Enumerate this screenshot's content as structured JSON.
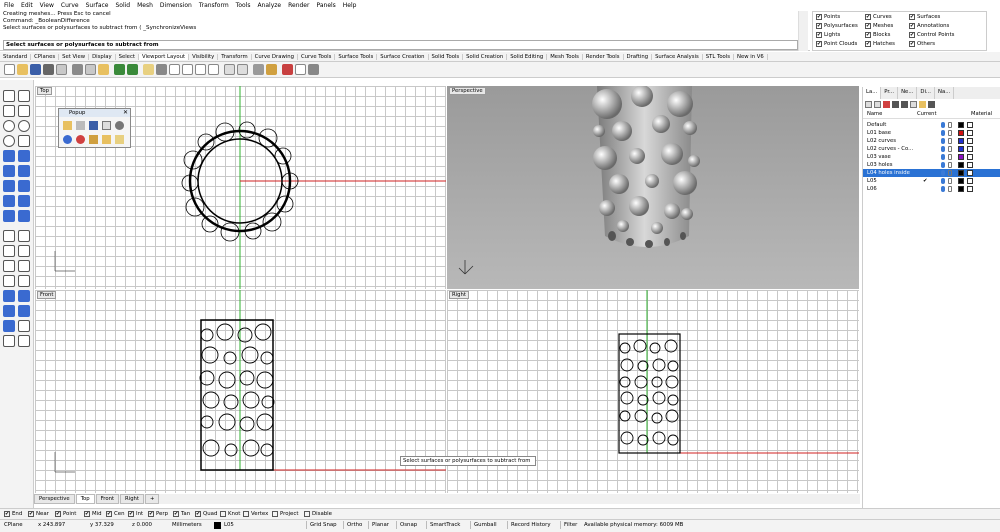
{
  "menu": [
    "File",
    "Edit",
    "View",
    "Curve",
    "Surface",
    "Solid",
    "Mesh",
    "Dimension",
    "Transform",
    "Tools",
    "Analyze",
    "Render",
    "Panels",
    "Help"
  ],
  "command": {
    "history": [
      "Creating meshes... Press Esc to cancel",
      "Command: _BooleanDifference",
      "Select surfaces or polysurfaces to subtract from ( _SynchronizeViews"
    ],
    "prompt": "Select surfaces or polysurfaces to subtract from"
  },
  "filter_checks": [
    {
      "label": "Points",
      "checked": true
    },
    {
      "label": "Curves",
      "checked": true
    },
    {
      "label": "Surfaces",
      "checked": true
    },
    {
      "label": "Polysurfaces",
      "checked": true
    },
    {
      "label": "Meshes",
      "checked": true
    },
    {
      "label": "Annotations",
      "checked": true
    },
    {
      "label": "Lights",
      "checked": true
    },
    {
      "label": "Blocks",
      "checked": true
    },
    {
      "label": "Control Points",
      "checked": true
    },
    {
      "label": "Point Clouds",
      "checked": true
    },
    {
      "label": "Hatches",
      "checked": true
    },
    {
      "label": "Others",
      "checked": true
    }
  ],
  "toolbar_tabs": [
    "Standard",
    "CPlanes",
    "Set View",
    "Display",
    "Select",
    "Viewport Layout",
    "Visibility",
    "Transform",
    "Curve Drawing",
    "Curve Tools",
    "Surface Tools",
    "Surface Creation",
    "Solid Tools",
    "Solid Creation",
    "Solid Editing",
    "Mesh Tools",
    "Render Tools",
    "Drafting",
    "Surface Analysis",
    "STL Tools",
    "New in V6"
  ],
  "active_toolbar_tab": "Viewport Layout",
  "viewports": {
    "top": "Top",
    "perspective": "Perspective",
    "front": "Front",
    "right": "Right"
  },
  "popup": {
    "title": "Popup"
  },
  "panel_tabs": [
    "La...",
    "Pr...",
    "Ne...",
    "Di...",
    "Na..."
  ],
  "layers": {
    "headers": {
      "name": "Name",
      "current": "Current",
      "material": "Material"
    },
    "rows": [
      {
        "name": "Default",
        "current": "",
        "color": "#000000",
        "selected": false
      },
      {
        "name": "L01 base",
        "current": "",
        "color": "#d01010",
        "selected": false
      },
      {
        "name": "L02 curves",
        "current": "",
        "color": "#2030d0",
        "selected": false
      },
      {
        "name": "L02 curves - Co...",
        "current": "",
        "color": "#2030d0",
        "selected": false
      },
      {
        "name": "L03 vase",
        "current": "",
        "color": "#8a10c0",
        "selected": false
      },
      {
        "name": "L03 holes",
        "current": "",
        "color": "#000000",
        "selected": false
      },
      {
        "name": "L04 holes inside",
        "current": "",
        "color": "#000000",
        "selected": true
      },
      {
        "name": "L05",
        "current": "✔",
        "color": "#000000",
        "selected": false
      },
      {
        "name": "L06",
        "current": "",
        "color": "#000000",
        "selected": false
      }
    ]
  },
  "viewport_tabs": [
    "Perspective",
    "Top",
    "Front",
    "Right",
    "+"
  ],
  "active_viewport_tab": "Top",
  "osnaps": [
    {
      "label": "End",
      "checked": true
    },
    {
      "label": "Near",
      "checked": true
    },
    {
      "label": "Point",
      "checked": true
    },
    {
      "label": "Mid",
      "checked": true
    },
    {
      "label": "Cen",
      "checked": true
    },
    {
      "label": "Int",
      "checked": true
    },
    {
      "label": "Perp",
      "checked": true
    },
    {
      "label": "Tan",
      "checked": true
    },
    {
      "label": "Quad",
      "checked": true
    },
    {
      "label": "Knot",
      "checked": false
    },
    {
      "label": "Vertex",
      "checked": false
    },
    {
      "label": "Project",
      "checked": false
    },
    {
      "label": "Disable",
      "checked": false
    }
  ],
  "status": {
    "cplane": "CPlane",
    "x": "x 243.897",
    "y": "y 37.329",
    "z": "z 0.000",
    "units": "Millimeters",
    "layer": "L05",
    "panes": [
      "Grid Snap",
      "Ortho",
      "Planar",
      "Osnap",
      "SmartTrack",
      "Gumball",
      "Record History",
      "Filter"
    ],
    "message": "Available physical memory: 6009 MB"
  },
  "tooltip": "Select surfaces or polysurfaces to subtract from"
}
